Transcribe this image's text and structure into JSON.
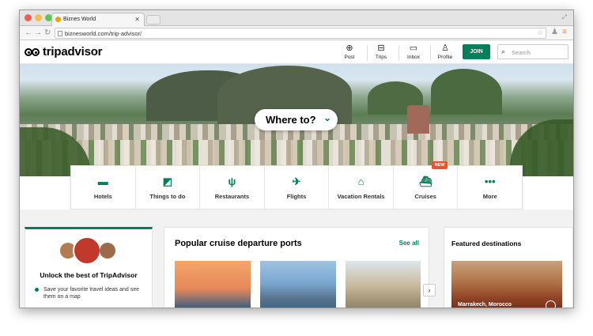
{
  "browser": {
    "tab_title": "Biznes World",
    "url": "biznesworld.com/trip-advisor/"
  },
  "header": {
    "logo_text": "tripadvisor",
    "nav": [
      {
        "label": "Post",
        "icon": "plus-circle-icon"
      },
      {
        "label": "Trips",
        "icon": "suitcase-icon"
      },
      {
        "label": "Inbox",
        "icon": "chat-bubble-icon"
      },
      {
        "label": "Profile",
        "icon": "person-icon"
      }
    ],
    "join_label": "JOIN",
    "search_placeholder": "Search"
  },
  "hero": {
    "where_to": "Where to?"
  },
  "categories": [
    {
      "label": "Hotels",
      "icon": "bed-icon",
      "badge": ""
    },
    {
      "label": "Things to do",
      "icon": "ticket-icon",
      "badge": ""
    },
    {
      "label": "Restaurants",
      "icon": "cutlery-icon",
      "badge": ""
    },
    {
      "label": "Flights",
      "icon": "airplane-icon",
      "badge": ""
    },
    {
      "label": "Vacation Rentals",
      "icon": "house-icon",
      "badge": ""
    },
    {
      "label": "Cruises",
      "icon": "ship-icon",
      "badge": "NEW"
    },
    {
      "label": "More",
      "icon": "more-dots-icon",
      "badge": ""
    }
  ],
  "unlock": {
    "title": "Unlock the best of TripAdvisor",
    "bullet": "Save your favorite travel ideas and see them on a map"
  },
  "ports": {
    "title": "Popular cruise departure ports",
    "see_all": "See all"
  },
  "featured": {
    "title": "Featured destinations",
    "caption": "Marrakech, Morocco"
  },
  "colors": {
    "accent": "#00805a",
    "badge": "#e6562c"
  }
}
